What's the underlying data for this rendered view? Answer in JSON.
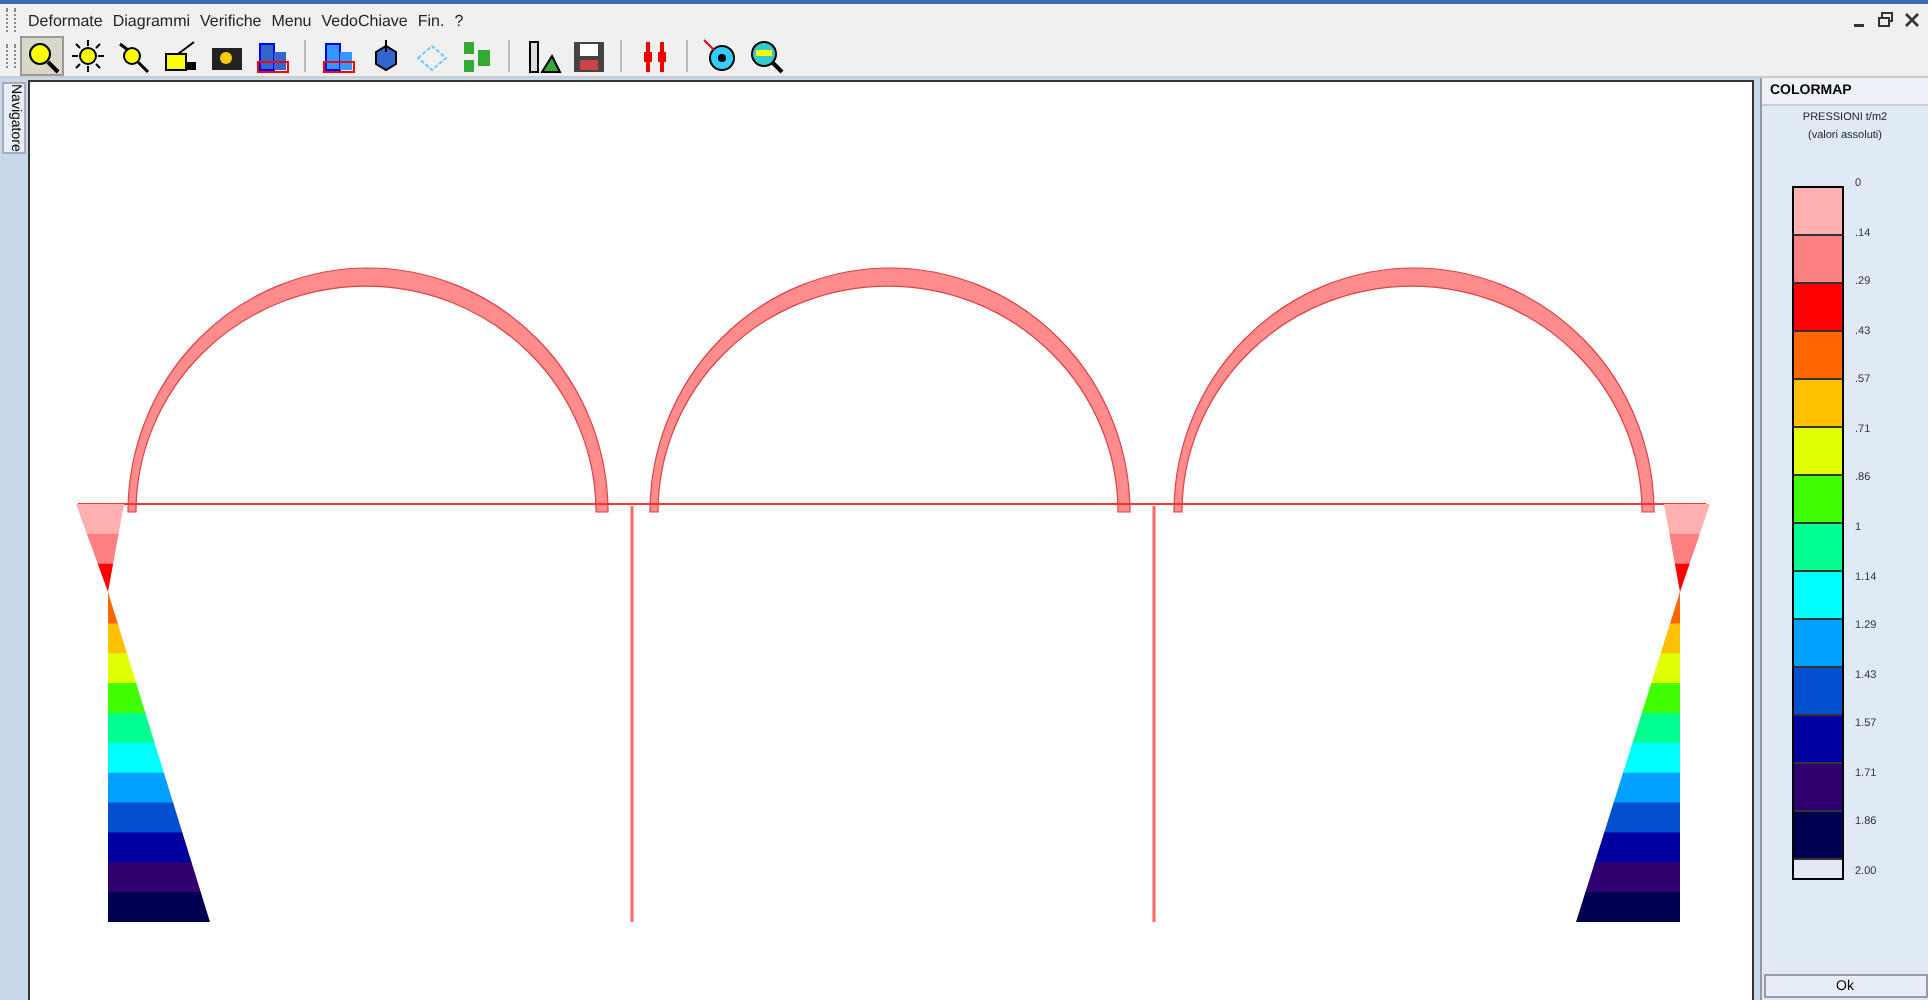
{
  "menu": [
    "Deformate",
    "Diagrammi",
    "Verifiche",
    "Menu",
    "VedoChiave",
    "Fin.",
    "?"
  ],
  "toolbar": [
    {
      "selected": true
    },
    {
      "selected": false
    },
    {
      "selected": false
    },
    {
      "selected": false
    },
    {
      "selected": false
    },
    {
      "selected": false
    },
    {
      "selected": false
    },
    {
      "selected": false
    },
    {
      "selected": false
    },
    {
      "selected": false
    },
    {
      "selected": false
    },
    {
      "selected": false
    },
    {
      "selected": false
    },
    {
      "selected": false
    },
    {
      "selected": false
    }
  ],
  "side_tab": {
    "label": "Navigatore"
  },
  "colormap": {
    "title": "COLORMAP",
    "quantity": "PRESSIONI t/m2",
    "note": "(valori assoluti)",
    "bands": [
      {
        "color": "#ffb0b0"
      },
      {
        "color": "#ff8080"
      },
      {
        "color": "#ff0000"
      },
      {
        "color": "#ff6600"
      },
      {
        "color": "#ffc000"
      },
      {
        "color": "#e0ff00"
      },
      {
        "color": "#40ff00"
      },
      {
        "color": "#00ff90"
      },
      {
        "color": "#00ffff"
      },
      {
        "color": "#00a0ff"
      },
      {
        "color": "#0050d0"
      },
      {
        "color": "#0000a0"
      },
      {
        "color": "#300070"
      },
      {
        "color": "#000050"
      }
    ],
    "labels": [
      "0",
      ".14",
      ".29",
      ".43",
      ".57",
      ".71",
      ".86",
      "1",
      "1.14",
      "1.29",
      "1.43",
      "1.57",
      "1.71",
      "1.86",
      "2.00"
    ],
    "button": "Ok"
  }
}
